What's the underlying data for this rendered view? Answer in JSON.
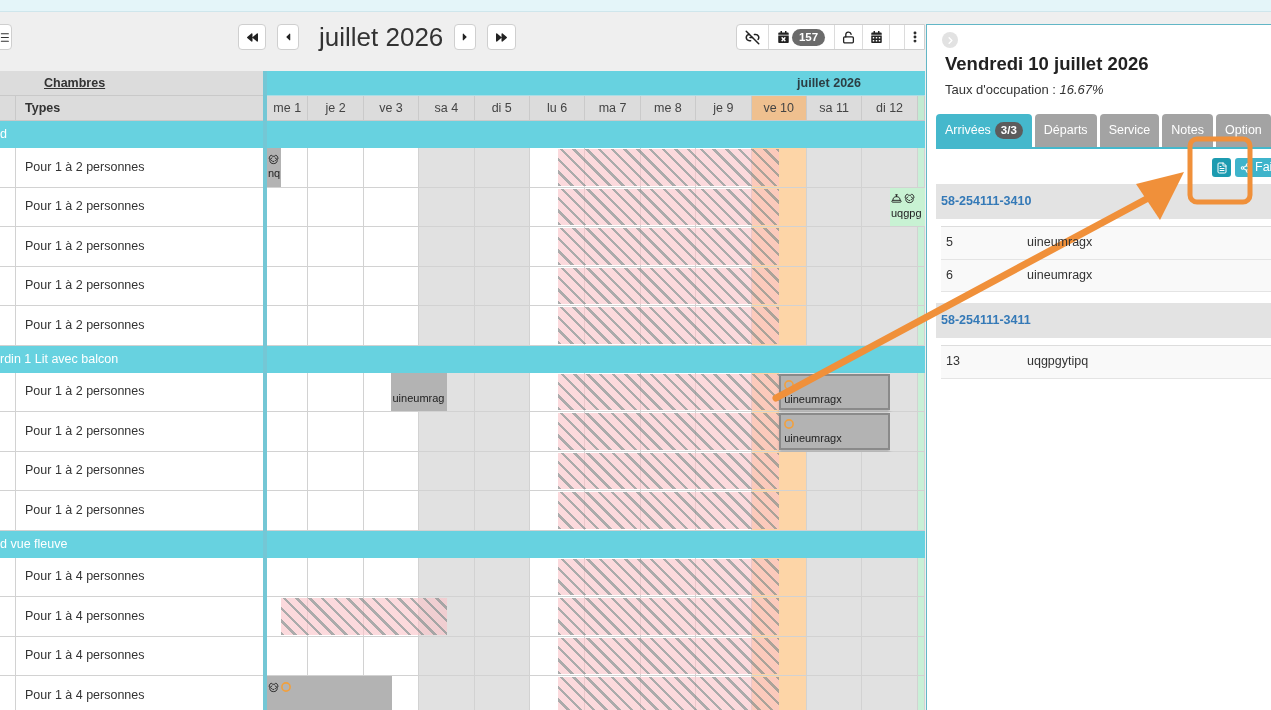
{
  "toolbar": {
    "title": "juillet 2026",
    "count": "157"
  },
  "rooms_header": {
    "title": "Chambres",
    "types": "Types"
  },
  "calendar": {
    "month": "juillet 2026",
    "days": [
      {
        "label": "me 1",
        "weekend": false,
        "selected": false,
        "marked": false
      },
      {
        "label": "je 2",
        "weekend": false,
        "selected": false,
        "marked": false
      },
      {
        "label": "ve 3",
        "weekend": false,
        "selected": false,
        "marked": false
      },
      {
        "label": "sa 4",
        "weekend": true,
        "selected": false,
        "marked": false
      },
      {
        "label": "di 5",
        "weekend": true,
        "selected": false,
        "marked": false
      },
      {
        "label": "lu 6",
        "weekend": false,
        "selected": false,
        "marked": false
      },
      {
        "label": "ma 7",
        "weekend": false,
        "selected": false,
        "marked": false
      },
      {
        "label": "me 8",
        "weekend": false,
        "selected": false,
        "marked": false
      },
      {
        "label": "je 9",
        "weekend": false,
        "selected": false,
        "marked": false
      },
      {
        "label": "ve 10",
        "weekend": false,
        "selected": true,
        "marked": false
      },
      {
        "label": "sa 11",
        "weekend": true,
        "selected": false,
        "marked": false
      },
      {
        "label": "di 12",
        "weekend": true,
        "selected": false,
        "marked": false
      },
      {
        "weekend": false,
        "selected": false,
        "marked": true
      }
    ]
  },
  "groups": [
    {
      "name": "d",
      "rooms": [
        {
          "type": "Pour 1 à 2 personnes",
          "cells": [
            {
              "kind": "booking_end",
              "guest": "nq",
              "color": "#b3b3b3",
              "selected": false,
              "icons": [
                {
                  "kind": "pet"
                }
              ]
            },
            {
              "kind": "free"
            },
            {
              "kind": "free"
            },
            {
              "kind": "free"
            },
            {
              "kind": "free"
            },
            {
              "kind": "closed_start"
            },
            {
              "kind": "closed"
            },
            {
              "kind": "closed"
            },
            {
              "kind": "closed"
            },
            {
              "kind": "closed_end"
            },
            {
              "kind": "free"
            },
            {
              "kind": "free"
            },
            {
              "kind": "free"
            }
          ]
        },
        {
          "type": "Pour 1 à 2 personnes",
          "cells": [
            {
              "kind": "free"
            },
            {
              "kind": "free"
            },
            {
              "kind": "free"
            },
            {
              "kind": "free"
            },
            {
              "kind": "free"
            },
            {
              "kind": "closed_start"
            },
            {
              "kind": "closed"
            },
            {
              "kind": "closed"
            },
            {
              "kind": "closed"
            },
            {
              "kind": "closed_end"
            },
            {
              "kind": "free"
            },
            {
              "kind": "booking_start",
              "guest": "uqgpg",
              "color": "#c8f2d3",
              "selected": false,
              "icons": [
                {
                  "kind": "bell"
                },
                {
                  "kind": "pet"
                }
              ]
            },
            {
              "kind": "booking"
            }
          ]
        },
        {
          "type": "Pour 1 à 2 personnes",
          "cells": [
            {
              "kind": "free"
            },
            {
              "kind": "free"
            },
            {
              "kind": "free"
            },
            {
              "kind": "free"
            },
            {
              "kind": "free"
            },
            {
              "kind": "closed_start"
            },
            {
              "kind": "closed"
            },
            {
              "kind": "closed"
            },
            {
              "kind": "closed"
            },
            {
              "kind": "closed_end"
            },
            {
              "kind": "free"
            },
            {
              "kind": "free"
            },
            {
              "kind": "free"
            }
          ]
        },
        {
          "type": "Pour 1 à 2 personnes",
          "cells": [
            {
              "kind": "free"
            },
            {
              "kind": "free"
            },
            {
              "kind": "free"
            },
            {
              "kind": "free"
            },
            {
              "kind": "free"
            },
            {
              "kind": "closed_start"
            },
            {
              "kind": "closed"
            },
            {
              "kind": "closed"
            },
            {
              "kind": "closed"
            },
            {
              "kind": "closed_end"
            },
            {
              "kind": "free"
            },
            {
              "kind": "free"
            },
            {
              "kind": "free"
            }
          ]
        },
        {
          "type": "Pour 1 à 2 personnes",
          "cells": [
            {
              "kind": "free"
            },
            {
              "kind": "free"
            },
            {
              "kind": "free"
            },
            {
              "kind": "free"
            },
            {
              "kind": "free"
            },
            {
              "kind": "closed_start"
            },
            {
              "kind": "closed"
            },
            {
              "kind": "closed"
            },
            {
              "kind": "closed"
            },
            {
              "kind": "closed_end"
            },
            {
              "kind": "free"
            },
            {
              "kind": "free"
            },
            {
              "kind": "free"
            }
          ]
        }
      ]
    },
    {
      "name": "rdin 1 Lit avec balcon",
      "rooms": [
        {
          "type": "Pour 1 à 2 personnes",
          "cells": [
            {
              "kind": "free"
            },
            {
              "kind": "free"
            },
            {
              "kind": "booking_start",
              "guest": "uineumrag",
              "color": "#b3b3b3",
              "selected": false
            },
            {
              "kind": "booking_end"
            },
            {
              "kind": "free"
            },
            {
              "kind": "closed_start"
            },
            {
              "kind": "closed"
            },
            {
              "kind": "closed"
            },
            {
              "kind": "closed"
            },
            {
              "kind": "closed_end_booking_start",
              "guest": "uineumragx",
              "color": "#b3b3b3",
              "selected": true,
              "icons": [
                {
                  "kind": "ring"
                }
              ]
            },
            {
              "kind": "booking"
            },
            {
              "kind": "booking_end"
            },
            {
              "kind": "free"
            }
          ]
        },
        {
          "type": "Pour 1 à 2 personnes",
          "cells": [
            {
              "kind": "free"
            },
            {
              "kind": "free"
            },
            {
              "kind": "free"
            },
            {
              "kind": "free"
            },
            {
              "kind": "free"
            },
            {
              "kind": "closed_start"
            },
            {
              "kind": "closed"
            },
            {
              "kind": "closed"
            },
            {
              "kind": "closed"
            },
            {
              "kind": "closed_end_booking_start",
              "guest": "uineumragx",
              "color": "#b3b3b3",
              "selected": true,
              "icons": [
                {
                  "kind": "ring"
                }
              ]
            },
            {
              "kind": "booking"
            },
            {
              "kind": "booking_end"
            },
            {
              "kind": "free"
            }
          ]
        },
        {
          "type": "Pour 1 à 2 personnes",
          "cells": [
            {
              "kind": "free"
            },
            {
              "kind": "free"
            },
            {
              "kind": "free"
            },
            {
              "kind": "free"
            },
            {
              "kind": "free"
            },
            {
              "kind": "closed_start"
            },
            {
              "kind": "closed"
            },
            {
              "kind": "closed"
            },
            {
              "kind": "closed"
            },
            {
              "kind": "closed_end"
            },
            {
              "kind": "free"
            },
            {
              "kind": "free"
            },
            {
              "kind": "free"
            }
          ]
        },
        {
          "type": "Pour 1 à 2 personnes",
          "cells": [
            {
              "kind": "free"
            },
            {
              "kind": "free"
            },
            {
              "kind": "free"
            },
            {
              "kind": "free"
            },
            {
              "kind": "free"
            },
            {
              "kind": "closed_start"
            },
            {
              "kind": "closed"
            },
            {
              "kind": "closed"
            },
            {
              "kind": "closed"
            },
            {
              "kind": "closed_end"
            },
            {
              "kind": "free"
            },
            {
              "kind": "free"
            },
            {
              "kind": "free"
            }
          ]
        }
      ]
    },
    {
      "name": "d vue fleuve",
      "rooms": [
        {
          "type": "Pour 1 à 4 personnes",
          "cells": [
            {
              "kind": "free"
            },
            {
              "kind": "free"
            },
            {
              "kind": "free"
            },
            {
              "kind": "free"
            },
            {
              "kind": "free"
            },
            {
              "kind": "closed_start"
            },
            {
              "kind": "closed"
            },
            {
              "kind": "closed"
            },
            {
              "kind": "closed"
            },
            {
              "kind": "closed_end"
            },
            {
              "kind": "free"
            },
            {
              "kind": "free"
            },
            {
              "kind": "free"
            }
          ]
        },
        {
          "type": "Pour 1 à 4 personnes",
          "cells": [
            {
              "kind": "closed_start"
            },
            {
              "kind": "closed"
            },
            {
              "kind": "closed"
            },
            {
              "kind": "closed_end"
            },
            {
              "kind": "free"
            },
            {
              "kind": "closed_start"
            },
            {
              "kind": "closed"
            },
            {
              "kind": "closed"
            },
            {
              "kind": "closed"
            },
            {
              "kind": "closed_end"
            },
            {
              "kind": "free"
            },
            {
              "kind": "free"
            },
            {
              "kind": "free"
            }
          ]
        },
        {
          "type": "Pour 1 à 4 personnes",
          "cells": [
            {
              "kind": "free"
            },
            {
              "kind": "free"
            },
            {
              "kind": "free"
            },
            {
              "kind": "free"
            },
            {
              "kind": "free"
            },
            {
              "kind": "closed_start"
            },
            {
              "kind": "closed"
            },
            {
              "kind": "closed"
            },
            {
              "kind": "closed"
            },
            {
              "kind": "closed_end"
            },
            {
              "kind": "free"
            },
            {
              "kind": "free"
            },
            {
              "kind": "free"
            }
          ]
        },
        {
          "type": "Pour 1 à 4 personnes",
          "cells": [
            {
              "kind": "booking",
              "color": "#b3b3b3",
              "selected": false,
              "icons": [
                {
                  "kind": "pet"
                },
                {
                  "kind": "ring"
                }
              ]
            },
            {
              "kind": "booking"
            },
            {
              "kind": "booking_end"
            },
            {
              "kind": "free"
            },
            {
              "kind": "free"
            },
            {
              "kind": "closed_start"
            },
            {
              "kind": "closed"
            },
            {
              "kind": "closed"
            },
            {
              "kind": "closed"
            },
            {
              "kind": "closed_end"
            },
            {
              "kind": "free"
            },
            {
              "kind": "free"
            },
            {
              "kind": "free"
            }
          ]
        }
      ]
    }
  ],
  "panel": {
    "title": "Vendredi 10 juillet 2026",
    "occupancy": "Taux d'occupation : *16.67%*",
    "tabs": [
      {
        "label": "Arrivées",
        "badge": "3/3",
        "selected": true
      },
      {
        "label": "Départs",
        "selected": false
      },
      {
        "label": "Service",
        "selected": false
      },
      {
        "label": "Notes",
        "selected": false
      },
      {
        "label": "Option",
        "selected": false
      }
    ],
    "action_label": "Fai",
    "reservations": [
      {
        "number": "58-254111-3410",
        "guests": [
          {
            "room": "5",
            "name": "uineumragx"
          },
          {
            "room": "6",
            "name": "uineumragx"
          }
        ]
      },
      {
        "number": "58-254111-3411",
        "guests": [
          {
            "room": "13",
            "name": "uqgpgytipq"
          }
        ]
      }
    ]
  }
}
